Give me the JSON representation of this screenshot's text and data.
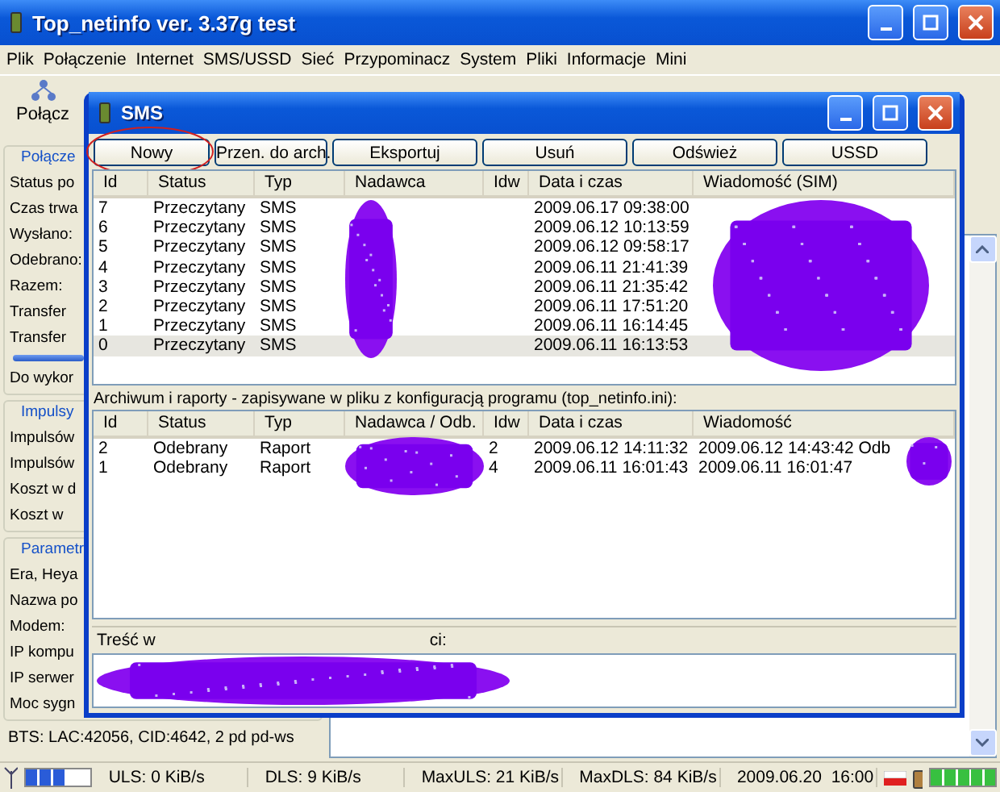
{
  "window": {
    "title": "Top_netinfo ver. 3.37g test"
  },
  "menu": [
    "Plik",
    "Połączenie",
    "Internet",
    "SMS/USSD",
    "Sieć",
    "Przypominacz",
    "System",
    "Pliki",
    "Informacje",
    "Mini"
  ],
  "toolbar": {
    "button": "Połącz"
  },
  "left_panel": {
    "groups": [
      {
        "title": "Połącze",
        "items": [
          {
            "kind": "label",
            "text": "Status po"
          },
          {
            "kind": "label",
            "text": "Czas trwa"
          },
          {
            "kind": "label",
            "text": "Wysłano:"
          },
          {
            "kind": "label",
            "text": "Odebrano:"
          },
          {
            "kind": "label",
            "text": "Razem:"
          },
          {
            "kind": "label",
            "text": "Transfer"
          },
          {
            "kind": "label",
            "text": "Transfer"
          },
          {
            "kind": "bar",
            "level": 1
          },
          {
            "kind": "label",
            "text": "Do wykor"
          }
        ]
      },
      {
        "title": "Impulsy",
        "items": [
          {
            "kind": "label",
            "text": "Impulsów"
          },
          {
            "kind": "label",
            "text": "Impulsów"
          },
          {
            "kind": "label",
            "text": "Koszt w d"
          },
          {
            "kind": "label",
            "text": "Koszt w"
          }
        ]
      },
      {
        "title": "Parametr",
        "items": [
          {
            "kind": "label",
            "text": "Era, Heya"
          },
          {
            "kind": "label",
            "text": "Nazwa po"
          },
          {
            "kind": "label",
            "text": "Modem:"
          },
          {
            "kind": "label",
            "text": "IP kompu"
          },
          {
            "kind": "label",
            "text": "IP serwer"
          },
          {
            "kind": "label",
            "text": "Moc sygn"
          }
        ]
      }
    ],
    "bts": "BTS: LAC:42056, CID:4642, 2 pd pd-ws"
  },
  "sms_window": {
    "title": "SMS",
    "buttons": [
      {
        "label": "Nowy",
        "circled": true
      },
      {
        "label": "Przen. do arch.",
        "circled": false
      },
      {
        "label": "Eksportuj",
        "circled": false
      },
      {
        "label": "Usuń",
        "circled": false
      },
      {
        "label": "Odśwież",
        "circled": false
      },
      {
        "label": "USSD",
        "circled": false
      }
    ],
    "inbox": {
      "columns": [
        "Id",
        "Status",
        "Typ",
        "Nadawca",
        "Idw",
        "Data i czas",
        "Wiadomość (SIM)"
      ],
      "rows": [
        {
          "id": "7",
          "status": "Przeczytany",
          "type": "SMS",
          "date": "2009.06.17 09:38:00",
          "selected": false
        },
        {
          "id": "6",
          "status": "Przeczytany",
          "type": "SMS",
          "date": "2009.06.12 10:13:59",
          "selected": false
        },
        {
          "id": "5",
          "status": "Przeczytany",
          "type": "SMS",
          "date": "2009.06.12 09:58:17",
          "selected": false
        },
        {
          "id": "4",
          "status": "Przeczytany",
          "type": "SMS",
          "date": "2009.06.11 21:41:39",
          "selected": false
        },
        {
          "id": "3",
          "status": "Przeczytany",
          "type": "SMS",
          "date": "2009.06.11 21:35:42",
          "selected": false
        },
        {
          "id": "2",
          "status": "Przeczytany",
          "type": "SMS",
          "date": "2009.06.11 17:51:20",
          "selected": false
        },
        {
          "id": "1",
          "status": "Przeczytany",
          "type": "SMS",
          "date": "2009.06.11 16:14:45",
          "selected": false
        },
        {
          "id": "0",
          "status": "Przeczytany",
          "type": "SMS",
          "date": "2009.06.11 16:13:53",
          "selected": true
        }
      ]
    },
    "archive": {
      "caption": "Archiwum i raporty - zapisywane w pliku z konfiguracją programu (top_netinfo.ini):",
      "columns": [
        "Id",
        "Status",
        "Typ",
        "Nadawca / Odb.",
        "Idw",
        "Data i czas",
        "Wiadomość"
      ],
      "rows": [
        {
          "id": "2",
          "status": "Odebrany",
          "type": "Raport",
          "idw": "2",
          "date": "2009.06.12 14:11:32",
          "message": "2009.06.12 14:43:42 Odb"
        },
        {
          "id": "1",
          "status": "Odebrany",
          "type": "Raport",
          "idw": "4",
          "date": "2009.06.11 16:01:43",
          "message": "2009.06.11 16:01:47"
        }
      ]
    },
    "message_label": [
      "Treść w",
      "ci:"
    ]
  },
  "status_bar": {
    "link_meter": {
      "level": 0.6
    },
    "uls": "ULS: 0 KiB/s",
    "dls": "DLS: 9 KiB/s",
    "max_uls": "MaxULS: 21 KiB/s",
    "max_dls": "MaxDLS: 84 KiB/s",
    "datetime": "2009.06.20  16:00",
    "battery": {
      "level": 1
    }
  }
}
